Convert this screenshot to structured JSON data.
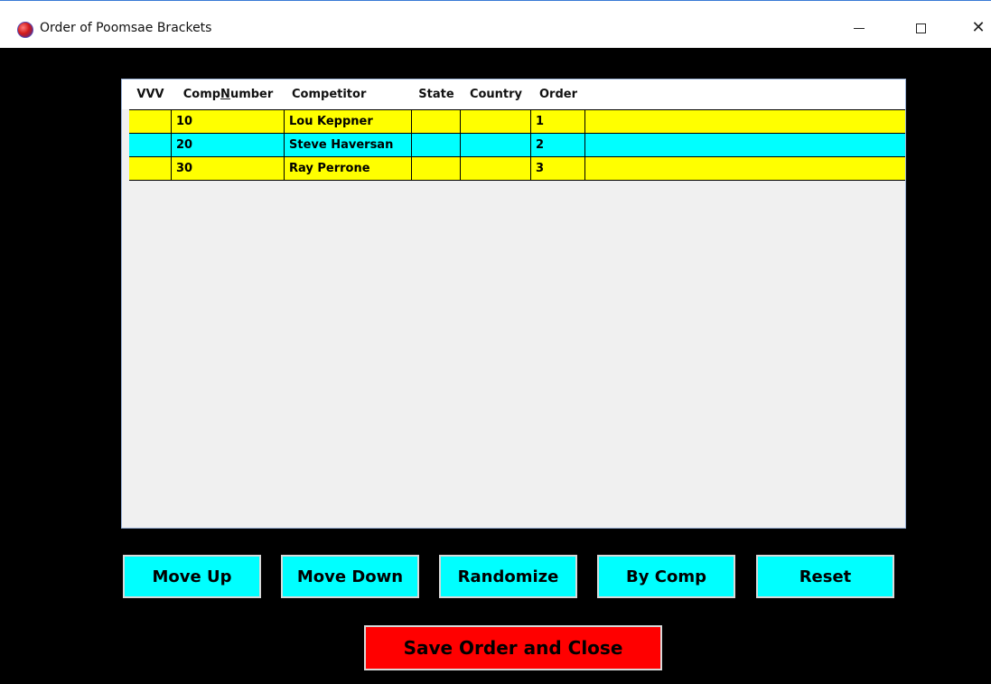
{
  "window": {
    "title": "Order of Poomsae Brackets",
    "icon": "app-globe-icon",
    "controls": {
      "minimize": "minimize-icon",
      "maximize": "maximize-icon",
      "close": "close-icon"
    }
  },
  "grid": {
    "columns": {
      "vvv": "VVV",
      "comp_prefix": "Comp",
      "comp_accel": "N",
      "comp_suffix": "umber",
      "competitor": "Competitor",
      "state": "State",
      "country": "Country",
      "order": "Order"
    },
    "rows": [
      {
        "vvv": "",
        "comp_number": "10",
        "competitor": "Lou Keppner",
        "state": "",
        "country": "",
        "order": "1",
        "color": "#ffff00"
      },
      {
        "vvv": "",
        "comp_number": "20",
        "competitor": "Steve Haversan",
        "state": "",
        "country": "",
        "order": "2",
        "color": "#00ffff"
      },
      {
        "vvv": "",
        "comp_number": "30",
        "competitor": "Ray Perrone",
        "state": "",
        "country": "",
        "order": "3",
        "color": "#ffff00"
      }
    ]
  },
  "buttons": {
    "move_up": "Move Up",
    "move_down": "Move Down",
    "randomize": "Randomize",
    "by_comp": "By Comp",
    "reset": "Reset",
    "save": "Save Order and Close"
  },
  "colors": {
    "background": "#000000",
    "button": "#00ffff",
    "save_button": "#ff0000",
    "row_yellow": "#ffff00",
    "row_cyan": "#00ffff"
  }
}
